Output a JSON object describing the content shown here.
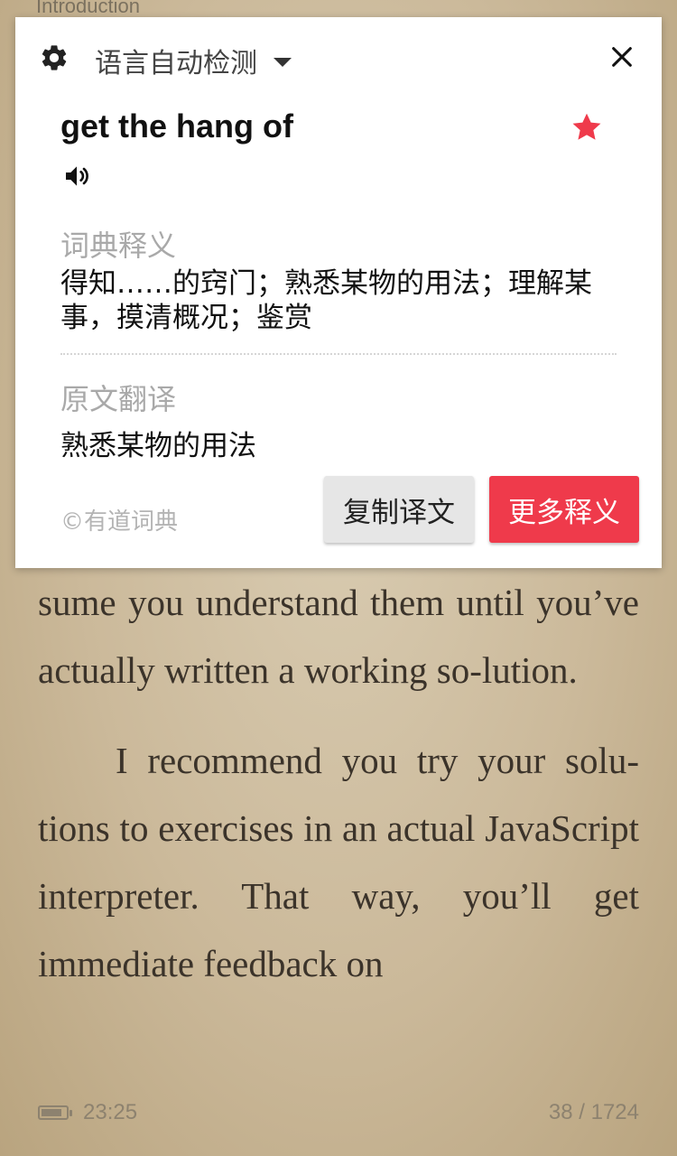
{
  "reader": {
    "chapter_title": "Introduction",
    "paragraphs": [
      "sume you understand them until you’ve actually written a working so-lution.",
      "I recommend you try your solu-tions to exercises in an actual JavaScript interpreter. That way, you’ll get immediate feedback on"
    ],
    "footer": {
      "time": "23:25",
      "page": "38 / 1724",
      "battery_level": 0.85
    }
  },
  "dictionary_popup": {
    "language_selector": "语言自动检测",
    "word": "get the hang of",
    "favorited": true,
    "dictionary_title": "词典释义",
    "dictionary_definition": "得知……的窍门；熟悉某物的用法；理解某事，摸清概况；鉴赏",
    "translation_title": "原文翻译",
    "translation_text": "熟悉某物的用法",
    "source": "©有道词典",
    "copy_button": "复制译文",
    "more_button": "更多释义",
    "icons": {
      "settings": "gear-icon",
      "close": "close-icon",
      "favorite": "star-icon",
      "pronounce": "speaker-icon",
      "dropdown": "caret-down-icon"
    },
    "accent_color": "#ef3a4b"
  }
}
